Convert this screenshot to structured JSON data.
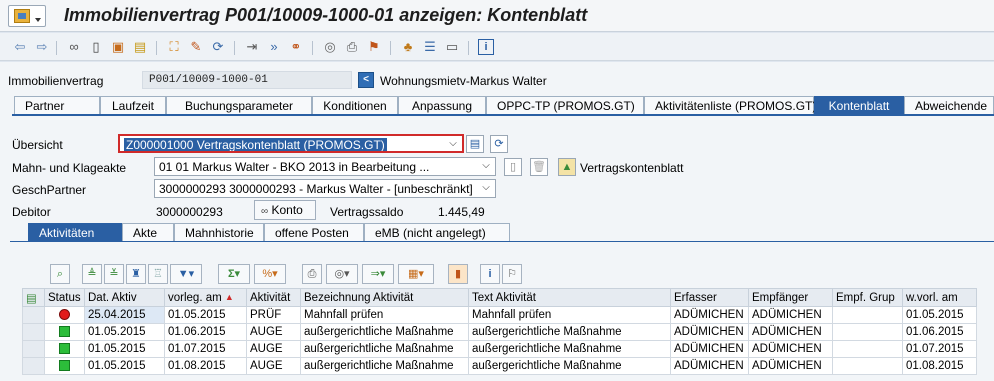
{
  "window": {
    "title": "Immobilienvertrag P001/10009-1000-01 anzeigen: Kontenblatt"
  },
  "toolbar": {
    "icons": [
      "back-icon",
      "forward-icon",
      "glasses-icon",
      "new-document-icon",
      "copy-icon",
      "clipboard-icon",
      "hierarchy-icon",
      "edit-icon",
      "refresh-icon",
      "exit-icon",
      "next-icon",
      "chain-icon",
      "target-icon",
      "print-icon",
      "flag-icon",
      "org-icon",
      "list-icon",
      "window-icon",
      "info-icon"
    ]
  },
  "header": {
    "contract_label": "Immobilienvertrag",
    "contract_value": "P001/10009-1000-01",
    "contract_desc": "Wohnungsmietv-Markus Walter"
  },
  "tabs": [
    {
      "label": "Partner"
    },
    {
      "label": "Laufzeit"
    },
    {
      "label": "Buchungsparameter"
    },
    {
      "label": "Konditionen"
    },
    {
      "label": "Anpassung"
    },
    {
      "label": "OPPC-TP (PROMOS.GT)"
    },
    {
      "label": "Aktivitätenliste (PROMOS.GT)"
    },
    {
      "label": "Kontenblatt"
    },
    {
      "label": "Abweichende"
    }
  ],
  "form": {
    "overview_label": "Übersicht",
    "overview_value": "Z000001000 Vertragskontenblatt (PROMOS.GT)",
    "dunning_label": "Mahn- und Klageakte",
    "dunning_value": "01 01 Markus Walter - BKO 2013 in Bearbeitung ...",
    "partner_label": "GeschPartner",
    "partner_value": "3000000293 3000000293 - Markus Walter - [unbeschränkt]",
    "debtor_label": "Debitor",
    "debtor_value": "3000000293",
    "account_button": "Konto",
    "balance_label": "Vertragssaldo",
    "balance_value": "1.445,49",
    "sheet_button": "Vertragskontenblatt"
  },
  "subtabs": [
    {
      "label": "Aktivitäten"
    },
    {
      "label": "Akte"
    },
    {
      "label": "Mahnhistorie"
    },
    {
      "label": "offene Posten"
    },
    {
      "label": "eMB (nicht angelegt)"
    }
  ],
  "grid": {
    "columns": [
      "Status",
      "Dat. Aktiv",
      "vorleg. am",
      "Aktivität",
      "Bezeichnung Aktivität",
      "Text Aktivität",
      "Erfasser",
      "Empfänger",
      "Empf. Grup",
      "w.vorl. am"
    ],
    "rows": [
      {
        "status": "red",
        "date": "25.04.2015",
        "vorleg": "01.05.2015",
        "akt": "PRÜF",
        "bez": "Mahnfall prüfen",
        "text": "Mahnfall prüfen",
        "erf": "ADÜMICHEN",
        "emp": "ADÜMICHEN",
        "grp": "",
        "wv": "01.05.2015"
      },
      {
        "status": "green",
        "date": "01.05.2015",
        "vorleg": "01.06.2015",
        "akt": "AUGE",
        "bez": "außergerichtliche Maßnahme",
        "text": "außergerichtliche Maßnahme",
        "erf": "ADÜMICHEN",
        "emp": "ADÜMICHEN",
        "grp": "",
        "wv": "01.06.2015"
      },
      {
        "status": "green",
        "date": "01.05.2015",
        "vorleg": "01.07.2015",
        "akt": "AUGE",
        "bez": "außergerichtliche Maßnahme",
        "text": "außergerichtliche Maßnahme",
        "erf": "ADÜMICHEN",
        "emp": "ADÜMICHEN",
        "grp": "",
        "wv": "01.07.2015"
      },
      {
        "status": "green",
        "date": "01.05.2015",
        "vorleg": "01.08.2015",
        "akt": "AUGE",
        "bez": "außergerichtliche Maßnahme",
        "text": "außergerichtliche Maßnahme",
        "erf": "ADÜMICHEN",
        "emp": "ADÜMICHEN",
        "grp": "",
        "wv": "01.08.2015"
      }
    ]
  }
}
